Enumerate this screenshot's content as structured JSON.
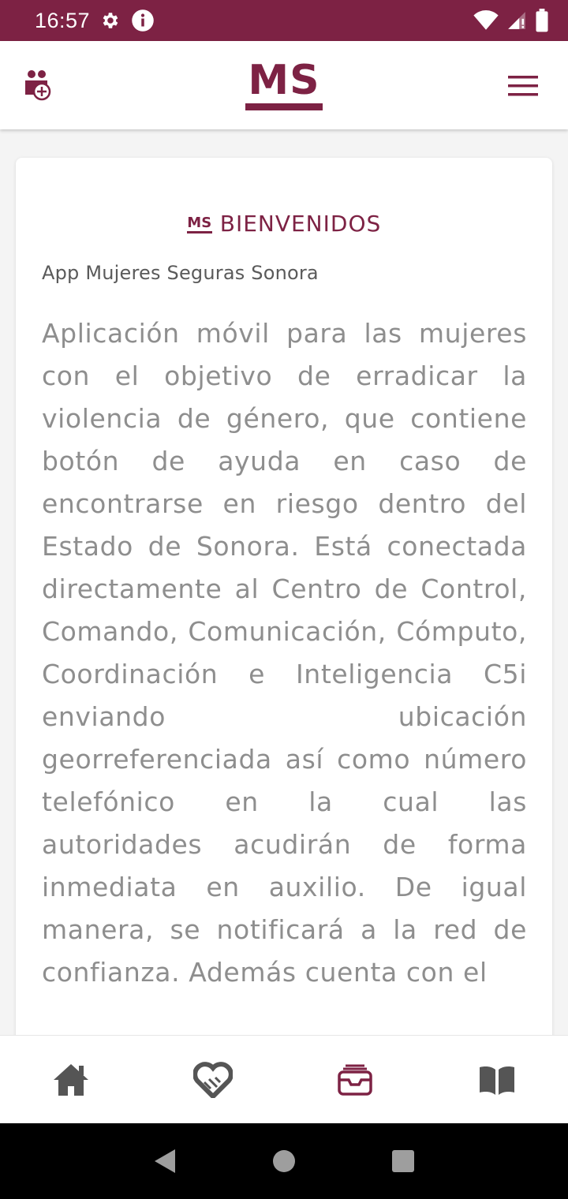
{
  "status_bar": {
    "time": "16:57",
    "left_icons": [
      "gear-icon",
      "info-icon"
    ],
    "right_icons": [
      "wifi-icon",
      "signal-icon",
      "battery-icon"
    ],
    "background_color": "#7d2244"
  },
  "header": {
    "logo_text": "MS",
    "left_icon": "add-group-icon",
    "right_icon": "menu-icon"
  },
  "card": {
    "logo_text": "MS",
    "title": "BIENVENIDOS",
    "subtitle": "App Mujeres Seguras Sonora",
    "description": "Aplicación móvil para las mujeres con el objetivo de erradicar la violencia de género, que contiene botón de ayuda en caso de encontrarse en riesgo dentro del Estado de Sonora. Está conectada directamente al Centro de Control, Comando, Comunicación, Cómputo, Coordinación e Inteligencia C5i enviando ubicación georreferenciada así como número telefónico en la cual las autoridades acudirán de forma inmediata en auxilio. De igual manera, se notificará a la red de confianza. Además cuenta con el"
  },
  "bottom_nav": {
    "items": [
      {
        "icon": "home-icon",
        "active": false
      },
      {
        "icon": "heart-hands-icon",
        "active": false
      },
      {
        "icon": "inbox-icon",
        "active": true
      },
      {
        "icon": "book-icon",
        "active": false
      }
    ],
    "active_color": "#7d2244",
    "inactive_color": "#555555"
  },
  "system_nav": {
    "icons": [
      "back-icon",
      "home-circle-icon",
      "recents-icon"
    ]
  }
}
